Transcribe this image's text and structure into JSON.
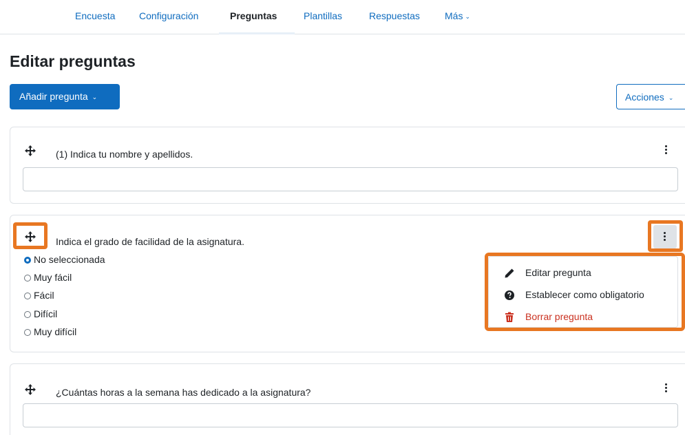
{
  "nav": {
    "tabs": [
      {
        "label": "Encuesta"
      },
      {
        "label": "Configuración"
      },
      {
        "label": "Preguntas"
      },
      {
        "label": "Plantillas"
      },
      {
        "label": "Respuestas"
      },
      {
        "label": "Más"
      }
    ]
  },
  "page_title": "Editar preguntas",
  "toolbar": {
    "add_question_label": "Añadir pregunta",
    "actions_label": "Acciones"
  },
  "questions": [
    {
      "text": "(1) Indica tu nombre y apellidos."
    },
    {
      "text": "Indica el grado de facilidad de la asignatura.",
      "options": [
        "No seleccionada",
        "Muy fácil",
        "Fácil",
        "Difícil",
        "Muy difícil"
      ],
      "selected": "No seleccionada"
    },
    {
      "text": "¿Cuántas horas a la semana has dedicado a la asignatura?"
    }
  ],
  "menu": {
    "items": [
      {
        "label": "Editar pregunta",
        "icon": "pencil-icon"
      },
      {
        "label": "Establecer como obligatorio",
        "icon": "question-circle-icon"
      },
      {
        "label": "Borrar pregunta",
        "icon": "trash-icon"
      }
    ]
  },
  "colors": {
    "primary": "#0f6cbf",
    "highlight": "#e87722",
    "danger": "#ca3120"
  }
}
